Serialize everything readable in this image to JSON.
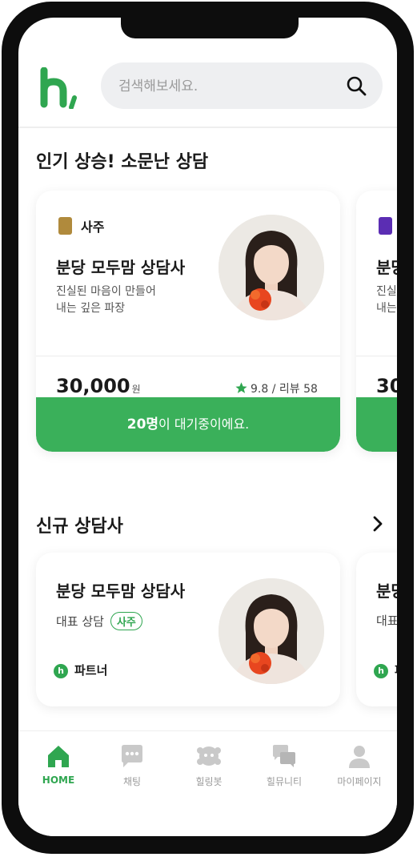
{
  "header": {
    "search_placeholder": "검색해보세요."
  },
  "popular": {
    "title": "인기 상승! 소문난 상담",
    "card": {
      "category": "사주",
      "name": "분당 모두맘 상담사",
      "desc_line1": "진실된 마음이 만들어",
      "desc_line2": "내는 깊은 파장",
      "price": "30,000",
      "price_unit": "원",
      "rating": "9.8 / 리뷰 58",
      "wait_count": "20명",
      "wait_text": "이 대기중이에요."
    },
    "peek": {
      "name": "분당",
      "desc_line1": "진실",
      "desc_line2": "내는",
      "price": "30"
    }
  },
  "new_counselors": {
    "title": "신규 상담사",
    "card": {
      "name": "분당 모두맘 상담사",
      "rep_label": "대표 상담",
      "tag": "사주",
      "partner": "파트너"
    },
    "peek": {
      "name": "분당",
      "rep": "대표",
      "partner": "파"
    }
  },
  "nav": {
    "items": [
      {
        "label": "HOME",
        "icon": "home-icon",
        "active": true
      },
      {
        "label": "채팅",
        "icon": "chat-icon",
        "active": false
      },
      {
        "label": "힐링봇",
        "icon": "bot-icon",
        "active": false
      },
      {
        "label": "힐뮤니티",
        "icon": "community-icon",
        "active": false
      },
      {
        "label": "마이페이지",
        "icon": "person-icon",
        "active": false
      }
    ]
  },
  "colors": {
    "brand_green": "#3ab05a",
    "category_gold": "#b08a3c",
    "category_purple": "#5b2db3",
    "star_green": "#2fa650"
  }
}
